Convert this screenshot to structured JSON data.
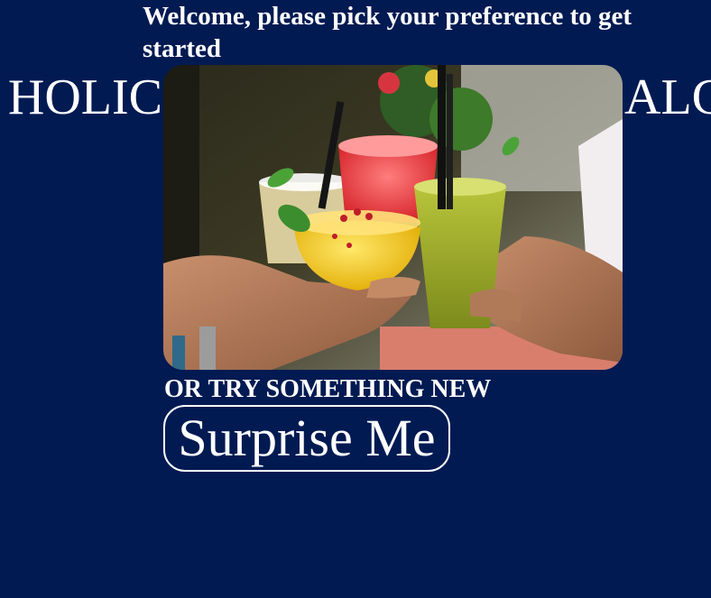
{
  "header": {
    "welcome_text": "Welcome, please pick your preference to get started"
  },
  "options": {
    "left_label": "HOLIC",
    "right_label": "ALC"
  },
  "hero": {
    "image_name": "cocktail-toast-photo"
  },
  "surprise": {
    "prompt": "OR TRY SOMETHING NEW",
    "button_label": "Surprise Me"
  },
  "colors": {
    "background": "#011a52",
    "text": "#ffffff"
  }
}
